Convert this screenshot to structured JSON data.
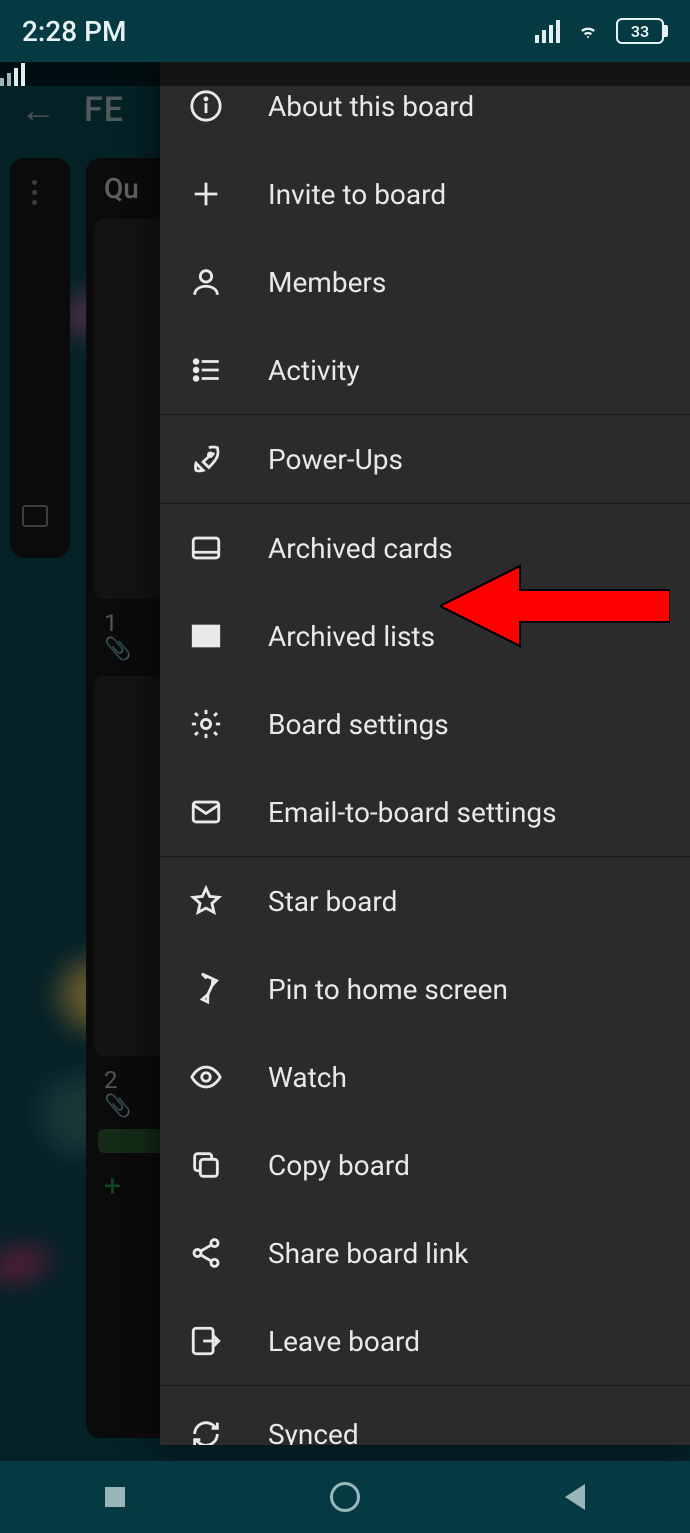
{
  "status": {
    "time": "2:28 PM",
    "battery": "33"
  },
  "appbar": {
    "title_fragment": "FE"
  },
  "list_preview": {
    "column2_title_fragment": "Qu",
    "card_num_a": "1",
    "card_num_b": "2"
  },
  "menu": {
    "items": [
      {
        "id": "about",
        "label": "About this board"
      },
      {
        "id": "invite",
        "label": "Invite to board"
      },
      {
        "id": "members",
        "label": "Members"
      },
      {
        "id": "activity",
        "label": "Activity"
      }
    ],
    "section2": [
      {
        "id": "powerups",
        "label": "Power-Ups"
      }
    ],
    "section3": [
      {
        "id": "archived_cards",
        "label": "Archived cards"
      },
      {
        "id": "archived_lists",
        "label": "Archived lists"
      },
      {
        "id": "board_settings",
        "label": "Board settings"
      },
      {
        "id": "email_settings",
        "label": "Email-to-board settings"
      }
    ],
    "section4": [
      {
        "id": "star",
        "label": "Star board"
      },
      {
        "id": "pin",
        "label": "Pin to home screen"
      },
      {
        "id": "watch",
        "label": "Watch"
      },
      {
        "id": "copy",
        "label": "Copy board"
      },
      {
        "id": "share",
        "label": "Share board link"
      },
      {
        "id": "leave",
        "label": "Leave board"
      }
    ],
    "section5": [
      {
        "id": "sync",
        "label": "Synced"
      }
    ]
  }
}
